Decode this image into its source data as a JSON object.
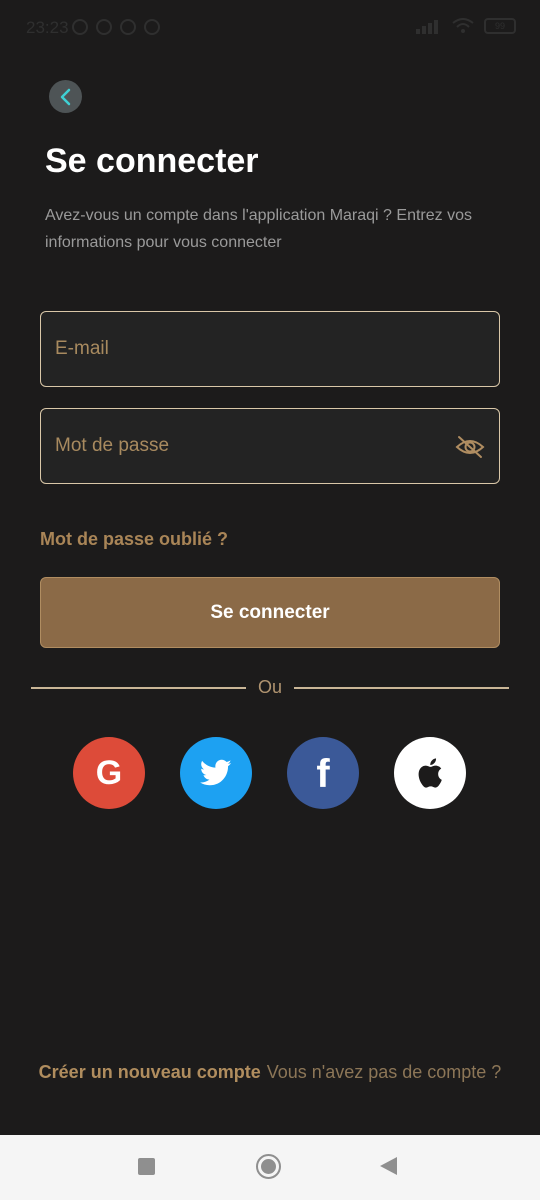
{
  "status_bar": {
    "time": "23:23",
    "battery": "99"
  },
  "header": {
    "title": "Se connecter",
    "subtitle": "Avez-vous un compte dans l'application Maraqi ? Entrez vos informations pour vous connecter"
  },
  "form": {
    "email_placeholder": "E-mail",
    "email_value": "",
    "password_placeholder": "Mot de passe",
    "password_value": "",
    "forgot_password": "Mot de passe oublié ?",
    "submit_label": "Se connecter"
  },
  "divider": {
    "label": "Ou"
  },
  "social": [
    {
      "name": "google",
      "icon": "google-icon",
      "color": "#dd4b39"
    },
    {
      "name": "twitter",
      "icon": "twitter-icon",
      "color": "#1da1f2"
    },
    {
      "name": "facebook",
      "icon": "facebook-icon",
      "color": "#3b5998"
    },
    {
      "name": "apple",
      "icon": "apple-icon",
      "color": "#ffffff"
    }
  ],
  "footer": {
    "create_account": "Créer un nouveau compte",
    "no_account": "Vous n'avez pas de compte ?"
  },
  "colors": {
    "background": "#1c1b1b",
    "accent": "#8b6a47",
    "field_border": "#d9c7a8",
    "link": "#a98557"
  }
}
